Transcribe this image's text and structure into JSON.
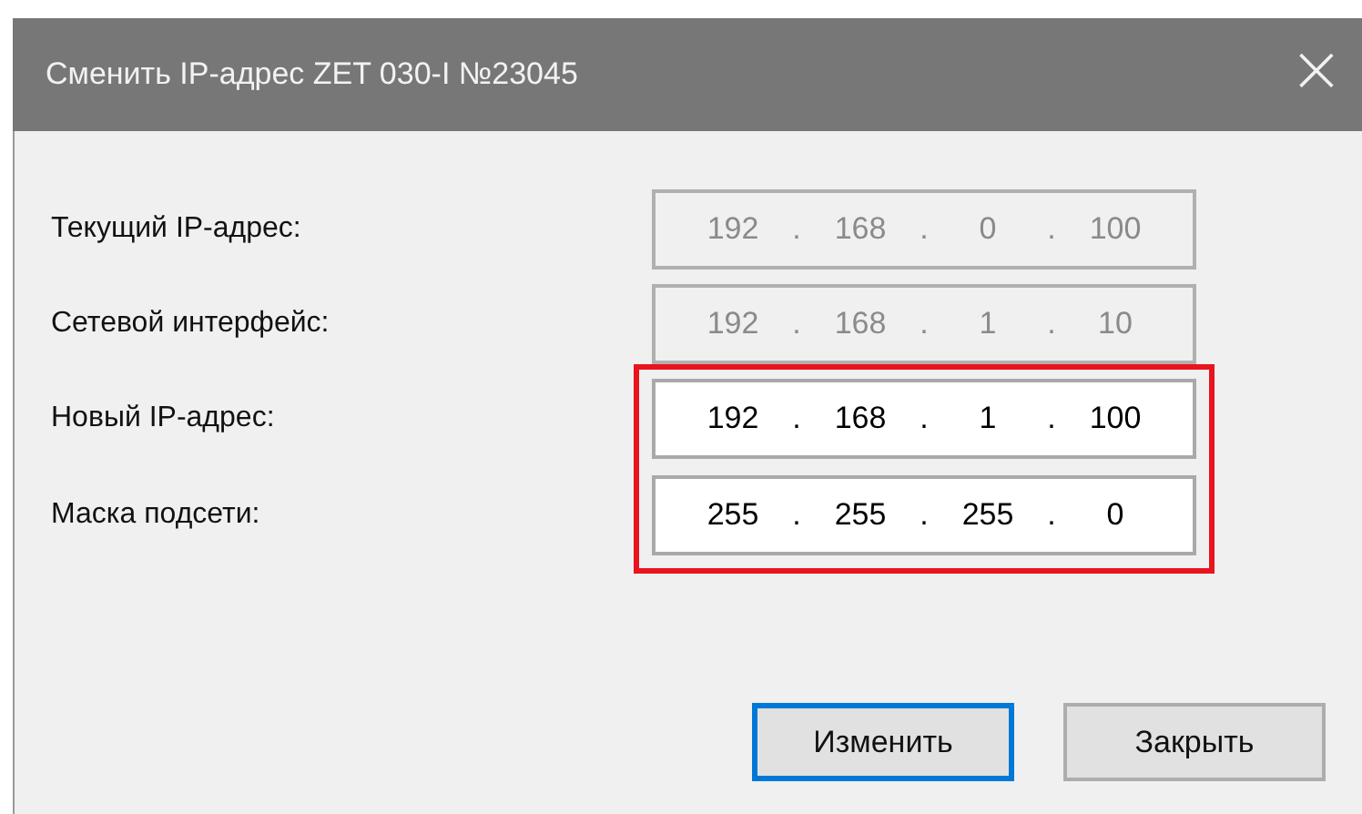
{
  "window": {
    "title": "Сменить IP-адрес ZET 030-I №23045",
    "close": "×"
  },
  "fields": [
    {
      "label": "Текущий IP-адрес:",
      "parts": [
        "192",
        ".",
        "168",
        ".",
        "0",
        ".",
        "100"
      ],
      "disabled": true,
      "highlighted": false
    },
    {
      "label": "Сетевой интерфейс:",
      "parts": [
        "192",
        ".",
        "168",
        ".",
        "1",
        ".",
        "10"
      ],
      "disabled": true,
      "highlighted": false
    },
    {
      "label": "Новый IP-адрес:",
      "parts": [
        "192",
        ".",
        "168",
        ".",
        "1",
        ".",
        "100"
      ],
      "disabled": false,
      "highlighted": true
    },
    {
      "label": "Маска подсети:",
      "parts": [
        "255",
        ".",
        "255",
        ".",
        "255",
        ".",
        "0"
      ],
      "disabled": false,
      "highlighted": true
    }
  ],
  "buttons": [
    {
      "label": "Изменить",
      "default": true
    },
    {
      "label": "Закрыть",
      "default": false
    }
  ]
}
